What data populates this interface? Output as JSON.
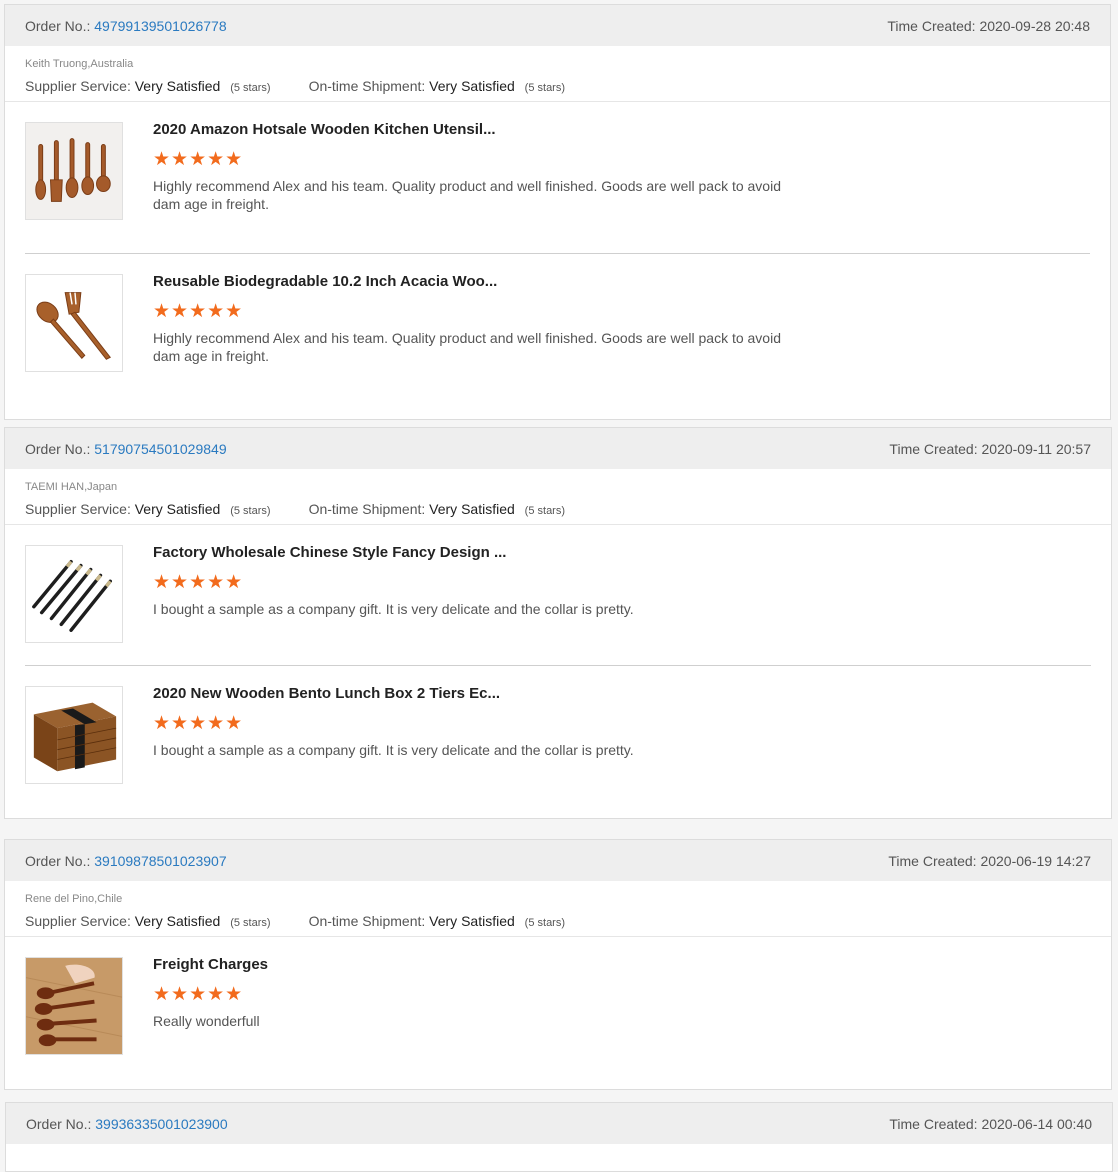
{
  "labels": {
    "order_no": "Order No.:",
    "time_created": "Time Created:",
    "supplier_service": "Supplier Service:",
    "ontime_shipment": "On-time Shipment:"
  },
  "colors": {
    "star": "#f26b1d",
    "link": "#2a7ac0"
  },
  "orders": [
    {
      "order_no": "49799139501026778",
      "time": "2020-09-28 20:48",
      "buyer": "Keith Truong,Australia",
      "supplier_value": "Very Satisfied",
      "supplier_stars": "(5 stars)",
      "shipment_value": "Very Satisfied",
      "shipment_stars": "(5 stars)",
      "items": [
        {
          "title": "2020 Amazon Hotsale Wooden Kitchen Utensil...",
          "stars": "★★★★★",
          "review": "Highly recommend Alex and his team. Quality product and well finished. Goods are well pack to avoid dam age in freight.",
          "image": "wooden-utensils-image"
        },
        {
          "title": "Reusable Biodegradable 10.2 Inch Acacia Woo...",
          "stars": "★★★★★",
          "review": "Highly recommend Alex and his team. Quality product and well finished. Goods are well pack to avoid dam age in freight.",
          "image": "wooden-spoon-fork-image"
        }
      ]
    },
    {
      "order_no": "51790754501029849",
      "time": "2020-09-11 20:57",
      "buyer": "TAEMI HAN,Japan",
      "supplier_value": "Very Satisfied",
      "supplier_stars": "(5 stars)",
      "shipment_value": "Very Satisfied",
      "shipment_stars": "(5 stars)",
      "items": [
        {
          "title": "Factory Wholesale Chinese Style Fancy Design ...",
          "stars": "★★★★★",
          "review": "I bought a sample as a company gift. It is very delicate and the collar is pretty.",
          "image": "chopsticks-image"
        },
        {
          "title": "2020 New Wooden Bento Lunch Box 2 Tiers Ec...",
          "stars": "★★★★★",
          "review": "I bought a sample as a company gift. It is very delicate and the collar is pretty.",
          "image": "bento-box-image"
        }
      ]
    },
    {
      "order_no": "39109878501023907",
      "time": "2020-06-19 14:27",
      "buyer": "Rene del Pino,Chile",
      "supplier_value": "Very Satisfied",
      "supplier_stars": "(5 stars)",
      "shipment_value": "Very Satisfied",
      "shipment_stars": "(5 stars)",
      "items": [
        {
          "title": "Freight Charges",
          "stars": "★★★★★",
          "review": "Really wonderfull",
          "image": "wooden-spoons-hand-image"
        }
      ]
    },
    {
      "order_no": "39936335001023900",
      "time": "2020-06-14 00:40"
    }
  ]
}
